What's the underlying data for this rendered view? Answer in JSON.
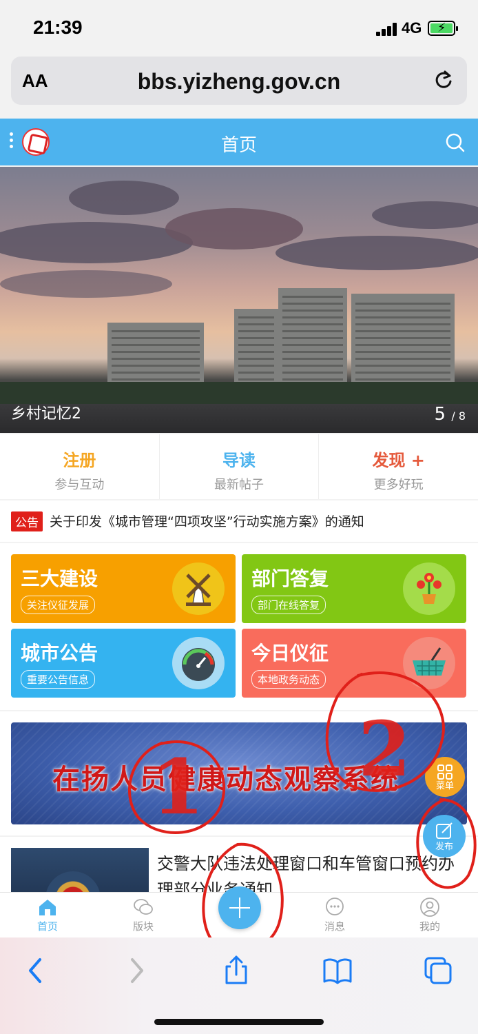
{
  "status_bar": {
    "time": "21:39",
    "network": "4G"
  },
  "browser": {
    "aa_label": "AA",
    "url": "bbs.yizheng.gov.cn"
  },
  "header": {
    "title": "首页"
  },
  "banner": {
    "caption": "乡村记忆2",
    "current": "5",
    "total": "/ 8"
  },
  "quick_nav": [
    {
      "title": "注册",
      "subtitle": "参与互动",
      "color": "#f5a623"
    },
    {
      "title": "导读",
      "subtitle": "最新帖子",
      "color": "#4db3ee"
    },
    {
      "title": "发现 +",
      "subtitle": "更多好玩",
      "color": "#e55a3c"
    }
  ],
  "notice": {
    "tag": "公告",
    "text": "关于印发《城市管理“四项攻坚”行动实施方案》的通知"
  },
  "grid": [
    {
      "title": "三大建设",
      "pill": "关注仪征发展",
      "color": "#f7a000",
      "icon": "windmill-icon"
    },
    {
      "title": "部门答复",
      "pill": "部门在线答复",
      "color": "#82c714",
      "icon": "flower-icon"
    },
    {
      "title": "城市公告",
      "pill": "重要公告信息",
      "color": "#34b3f0",
      "icon": "gauge-icon"
    },
    {
      "title": "今日仪征",
      "pill": "本地政务动态",
      "color": "#f96c5c",
      "icon": "basket-icon"
    }
  ],
  "ad": {
    "text": "在扬人员健康动态观察系统"
  },
  "news": {
    "title": "交警大队违法处理窗口和车管窗口预约办理部分业务通知"
  },
  "fab": {
    "menu_label": "菜单",
    "post_label": "发布"
  },
  "tabbar": [
    {
      "label": "首页",
      "icon": "home-icon"
    },
    {
      "label": "版块",
      "icon": "chat-bubbles-icon"
    },
    {
      "label": "消息",
      "icon": "message-icon"
    },
    {
      "label": "我的",
      "icon": "user-icon"
    }
  ],
  "annotations": [
    "1",
    "2"
  ],
  "colors": {
    "brand_blue": "#4db3ee",
    "annotation_red": "#e0201a"
  }
}
